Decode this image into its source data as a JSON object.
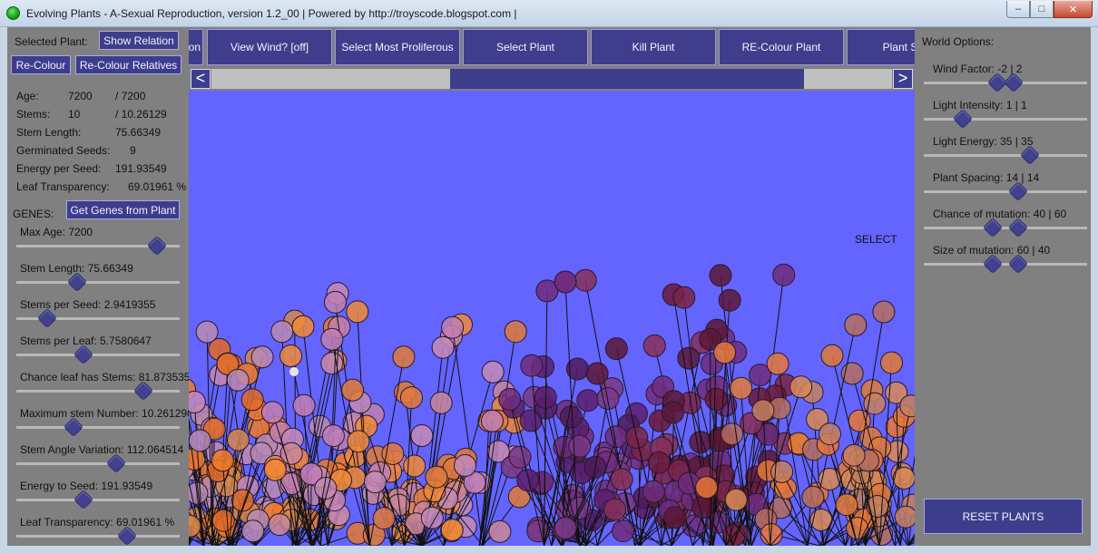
{
  "window": {
    "title": "Evolving Plants - A-Sexual Reproduction,  version 1.2_00   |   Powered by http://troyscode.blogspot.com   |",
    "minimize": "–",
    "maximize": "□",
    "close": "✕"
  },
  "left": {
    "selected_plant_label": "Selected Plant:",
    "show_relation_btn": "Show Relation",
    "recolour_btn": "Re-Colour",
    "recolour_relatives_btn": "Re-Colour Relatives",
    "stats": [
      {
        "label": "Age:",
        "value": "7200",
        "max": "/ 7200"
      },
      {
        "label": "Stems:",
        "value": "10",
        "max": "/ 10.26129"
      },
      {
        "label": "Stem Length:",
        "value": "75.66349",
        "max": ""
      },
      {
        "label": "Germinated Seeds:",
        "value": "9",
        "max": ""
      },
      {
        "label": "Energy per Seed:",
        "value": "191.93549",
        "max": ""
      },
      {
        "label": "Leaf Transparency:",
        "value": "69.01961 %",
        "max": ""
      }
    ],
    "genes_label": "GENES:",
    "get_genes_btn": "Get Genes from Plant",
    "genes": [
      {
        "label": "Max Age: 7200",
        "level": 0.86
      },
      {
        "label": "Stem Length: 75.66349",
        "level": 0.37
      },
      {
        "label": "Stems per Seed: 2.9419355",
        "level": 0.19
      },
      {
        "label": "Stems per Leaf: 5.7580647",
        "level": 0.41
      },
      {
        "label": "Chance leaf has Stems: 81.873535",
        "level": 0.78
      },
      {
        "label": "Maximum stem Number: 10.261290",
        "level": 0.35
      },
      {
        "label": "Stem Angle Variation: 112.064514",
        "level": 0.61
      },
      {
        "label": "Energy to Seed: 191.93549",
        "level": 0.41
      },
      {
        "label": "Leaf Transparency: 69.01961 %",
        "level": 0.68
      }
    ]
  },
  "toolbar": {
    "buttons": [
      "Show Selection",
      "View Wind?   [off]",
      "Select Most Proliferous",
      "Select Plant",
      "Kill Plant",
      "RE-Colour Plant",
      "Plant Seed"
    ],
    "scroll_left": "<",
    "scroll_right": ">",
    "scroll_thumb_start": 0.35,
    "scroll_thumb_span": 0.52
  },
  "simulation": {
    "mode_label": "SELECT",
    "background_color": "#6464ff"
  },
  "right": {
    "title": "World Options:",
    "options": [
      {
        "label": "Wind Factor: -2 | 2",
        "levels": [
          0.45,
          0.55
        ]
      },
      {
        "label": "Light Intensity: 1 | 1",
        "levels": [
          0.24
        ]
      },
      {
        "label": "Light Energy: 35 | 35",
        "levels": [
          0.65
        ]
      },
      {
        "label": "Plant Spacing: 14 | 14",
        "levels": [
          0.58
        ]
      },
      {
        "label": "Chance of mutation: 40 | 60",
        "levels": [
          0.42,
          0.58
        ]
      },
      {
        "label": "Size of mutation: 60 | 40",
        "levels": [
          0.42,
          0.58
        ]
      }
    ],
    "reset_btn": "RESET PLANTS"
  },
  "colors": {
    "panel": "#808080",
    "button": "#3e3d8c",
    "button_border": "#a9a9e6",
    "sim_background": "#6464ff",
    "leaf_orange": "#f07a2a",
    "leaf_pink": "#c48ab8",
    "leaf_purple": "#6e2d7e",
    "leaf_maroon": "#6a1a3a"
  }
}
